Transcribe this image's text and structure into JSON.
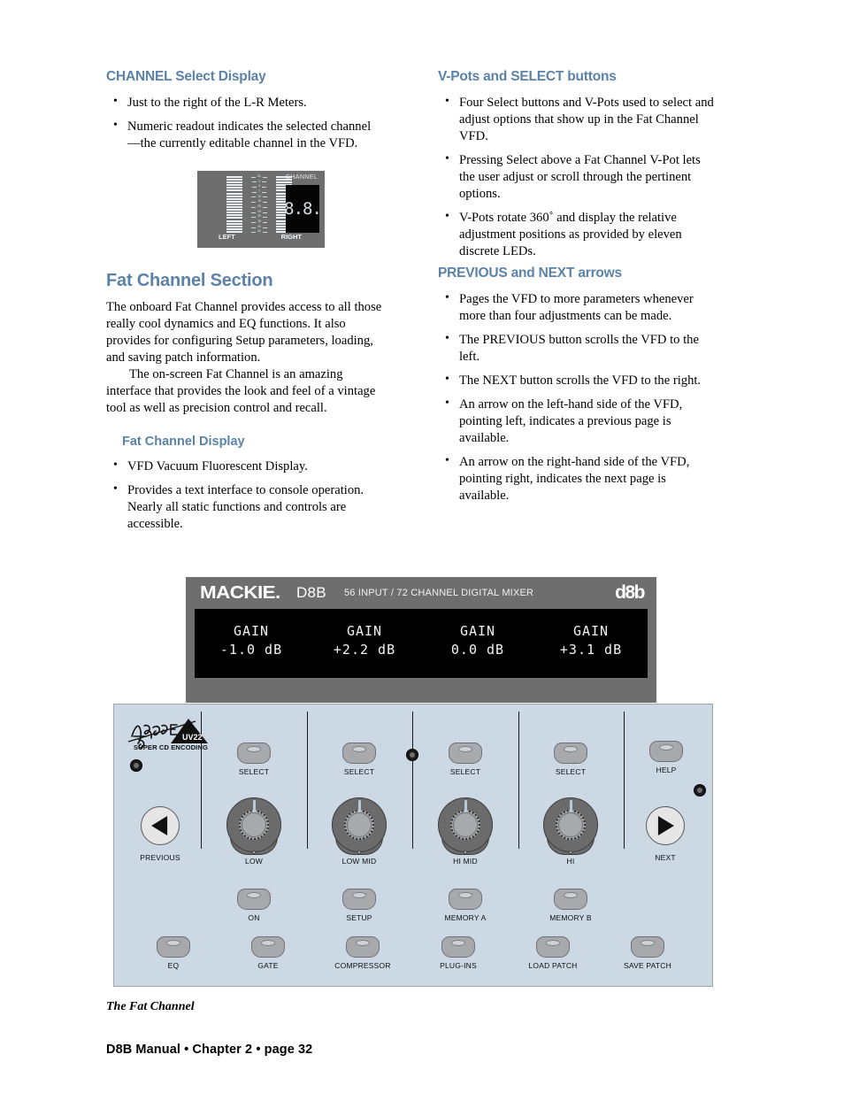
{
  "colors": {
    "heading": "#5b82a8",
    "panel_face": "#ccd8e3",
    "housing": "#6e6e6e",
    "vfd_screen": "#000000",
    "vfd_text": "#f2f2f2",
    "knob_body": "#6b6b6b",
    "cap_body": "#a7a9ac"
  },
  "left_column": {
    "section1": {
      "heading": "CHANNEL Select Display",
      "bullets": [
        "Just to the right of the L-R Meters.",
        "Numeric readout indicates the selected channel—the currently editable channel in the VFD."
      ]
    },
    "meter_figure": {
      "channel_label": "CHANNEL",
      "channel_readout": "8.8.",
      "left_label": "LEFT",
      "right_label": "RIGHT",
      "scale": [
        "OL",
        "2",
        "4",
        "7",
        "10",
        "15",
        "20",
        "25",
        "30",
        "35",
        "40",
        "50"
      ]
    },
    "section2": {
      "heading": "Fat Channel Section",
      "paragraph1": "The onboard Fat Channel provides access to all those really cool dynamics and EQ functions. It also provides for configuring Setup parameters, loading, and saving patch information.",
      "paragraph2": "The on-screen Fat Channel is an amazing interface that provides the look and feel of a vintage tool as well as precision control and recall.",
      "subheading": "Fat Channel Display",
      "bullets": [
        "VFD Vacuum Fluorescent Display.",
        "Provides a text interface to console operation. Nearly all static functions and controls are accessible."
      ]
    }
  },
  "right_column": {
    "section1": {
      "heading": "V-Pots and SELECT buttons",
      "bullets": [
        "Four Select buttons and V-Pots used to select and adjust options that show up in the Fat Channel VFD.",
        "Pressing Select above a Fat Channel V-Pot lets the user adjust or scroll through the pertinent options.",
        "V-Pots rotate 360˚ and display the relative adjustment positions as provided by eleven discrete LEDs."
      ]
    },
    "section2": {
      "heading": "PREVIOUS and NEXT arrows",
      "bullets": [
        "Pages the VFD to more parameters whenever more than four adjustments can be made.",
        "The PREVIOUS button scrolls the VFD to the left.",
        "The NEXT button scrolls the VFD to the right.",
        "An arrow on the left-hand side of the VFD, pointing left, indicates a previous page is available.",
        "An arrow on the right-hand side of the VFD, pointing right, indicates the next page is available."
      ]
    }
  },
  "mixer": {
    "header": {
      "brand": "MACKIE.",
      "model": "D8B",
      "subtitle": "56 INPUT / 72 CHANNEL DIGITAL MIXER",
      "logo": "d8b"
    },
    "vfd": {
      "columns": [
        {
          "param": "GAIN",
          "value": "-1.0 dB"
        },
        {
          "param": "GAIN",
          "value": "+2.2 dB"
        },
        {
          "param": "GAIN",
          "value": "0.0 dB"
        },
        {
          "param": "GAIN",
          "value": "+3.1 dB"
        }
      ]
    },
    "apogee": {
      "label": "SUPER CD ENCODING",
      "mark": "UV22"
    },
    "nav": {
      "previous": "PREVIOUS",
      "next": "NEXT",
      "help": "HELP"
    },
    "select_buttons": [
      "SELECT",
      "SELECT",
      "SELECT",
      "SELECT"
    ],
    "knobs": [
      "LOW",
      "LOW MID",
      "HI MID",
      "HI"
    ],
    "row3_buttons": [
      "ON",
      "SETUP",
      "MEMORY A",
      "MEMORY B"
    ],
    "row4_buttons": [
      "EQ",
      "GATE",
      "COMPRESSOR",
      "PLUG-INS",
      "LOAD PATCH",
      "SAVE PATCH"
    ]
  },
  "caption": "The Fat Channel",
  "footer": "D8B Manual • Chapter 2 • page 32"
}
